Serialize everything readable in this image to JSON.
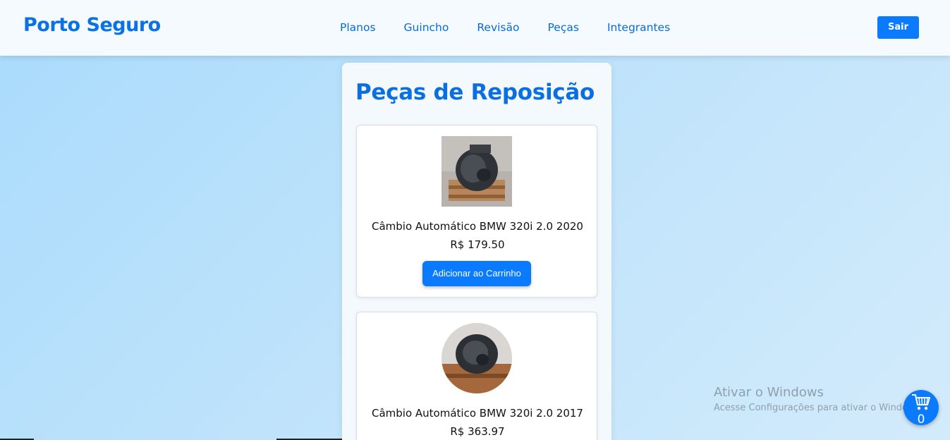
{
  "header": {
    "brand": "Porto Seguro",
    "nav": [
      "Planos",
      "Guincho",
      "Revisão",
      "Peças",
      "Integrantes"
    ],
    "logout_label": "Sair"
  },
  "page": {
    "title": "Peças de Reposição"
  },
  "products": [
    {
      "name": "Câmbio Automático BMW 320i 2.0 2020",
      "price": "R$ 179.50",
      "button_label": "Adicionar ao Carrinho",
      "image": "transmission-photo"
    },
    {
      "name": "Câmbio Automático BMW 320i 2.0 2017",
      "price": "R$ 363.97",
      "image": "transmission-photo"
    }
  ],
  "cart": {
    "icon": "cart-icon",
    "count": "0"
  },
  "watermark": {
    "title": "Ativar o Windows",
    "subtitle": "Acesse Configurações para ativar o Windows."
  },
  "colors": {
    "primary": "#0a7bff",
    "brand": "#0a72e6",
    "header_bg": "#f5fafe"
  }
}
